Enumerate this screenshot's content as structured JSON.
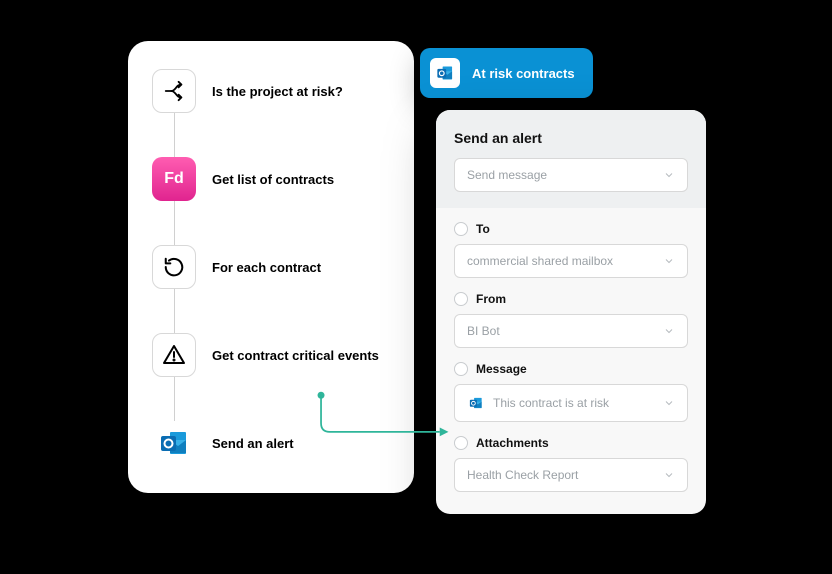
{
  "workflow": {
    "steps": [
      {
        "label": "Is the project at risk?",
        "icon": "branch"
      },
      {
        "label": "Get list of contracts",
        "icon": "fd",
        "fd_text": "Fd"
      },
      {
        "label": "For each contract",
        "icon": "loop"
      },
      {
        "label": "Get contract critical events",
        "icon": "warning"
      },
      {
        "label": "Send an alert",
        "icon": "outlook"
      }
    ]
  },
  "tag": {
    "label": "At risk contracts"
  },
  "alertPanel": {
    "title": "Send an alert",
    "action_placeholder": "Send message",
    "fields": {
      "to": {
        "label": "To",
        "value": "commercial shared mailbox"
      },
      "from": {
        "label": "From",
        "value": "BI Bot"
      },
      "message": {
        "label": "Message",
        "value": "This contract is at risk"
      },
      "attachments": {
        "label": "Attachments",
        "value": "Health Check Report"
      }
    }
  }
}
